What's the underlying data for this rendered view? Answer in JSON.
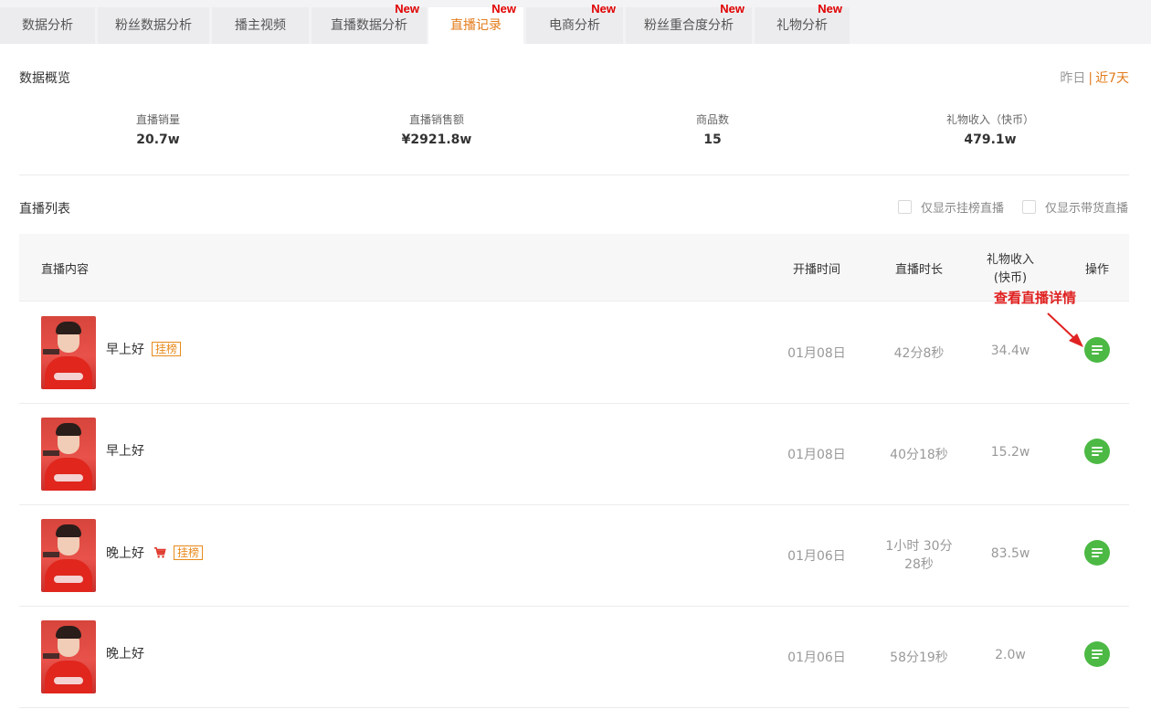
{
  "tabs": [
    {
      "label": "数据分析",
      "new": false,
      "active": false
    },
    {
      "label": "粉丝数据分析",
      "new": false,
      "active": false
    },
    {
      "label": "播主视频",
      "new": false,
      "active": false
    },
    {
      "label": "直播数据分析",
      "new": true,
      "active": false
    },
    {
      "label": "直播记录",
      "new": true,
      "active": true
    },
    {
      "label": "电商分析",
      "new": true,
      "active": false
    },
    {
      "label": "粉丝重合度分析",
      "new": true,
      "active": false
    },
    {
      "label": "礼物分析",
      "new": true,
      "active": false
    }
  ],
  "new_label": "New",
  "overview": {
    "title": "数据概览",
    "range_yesterday": "昨日",
    "range_sep": "|",
    "range_7days": "近7天",
    "stats": [
      {
        "label": "直播销量",
        "value": "20.7w"
      },
      {
        "label": "直播销售额",
        "value": "¥2921.8w"
      },
      {
        "label": "商品数",
        "value": "15"
      },
      {
        "label": "礼物收入（快币）",
        "value": "479.1w"
      }
    ]
  },
  "list": {
    "title": "直播列表",
    "filter_rank": "仅显示挂榜直播",
    "filter_goods": "仅显示带货直播",
    "headers": {
      "content": "直播内容",
      "start": "开播时间",
      "duration": "直播时长",
      "gift_line1": "礼物收入",
      "gift_line2": "(快币)",
      "action": "操作"
    },
    "rows": [
      {
        "title": "早上好",
        "rank_badge": "挂榜",
        "date": "01月08日",
        "duration": "42分8秒",
        "duration2": "",
        "gift": "34.4w"
      },
      {
        "title": "早上好",
        "rank_badge": "",
        "date": "01月08日",
        "duration": "40分18秒",
        "duration2": "",
        "gift": "15.2w"
      },
      {
        "title": "晚上好",
        "rank_badge": "挂榜",
        "cart": true,
        "date": "01月06日",
        "duration": "1小时 30分",
        "duration2": "28秒",
        "gift": "83.5w"
      },
      {
        "title": "晚上好",
        "rank_badge": "",
        "date": "01月06日",
        "duration": "58分19秒",
        "duration2": "",
        "gift": "2.0w"
      }
    ]
  },
  "annotation": "查看直播详情",
  "colors": {
    "accent": "#e37b1b",
    "new": "#e10000",
    "action": "#4cb944",
    "annotation": "#e02222"
  }
}
